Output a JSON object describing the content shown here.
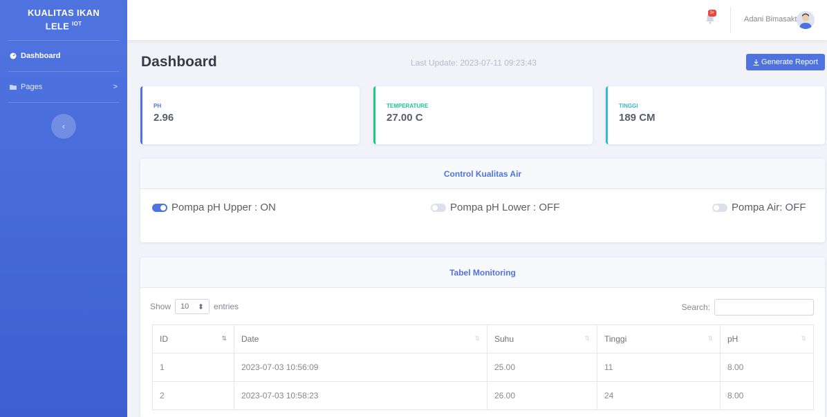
{
  "sidebar": {
    "brand_line1": "KUALITAS IKAN",
    "brand_line2": "LELE",
    "brand_sup": "IOT",
    "items": [
      {
        "label": "Dashboard",
        "icon": "tachometer-icon",
        "active": true
      },
      {
        "label": "Pages",
        "icon": "folder-icon",
        "chevron": ">"
      }
    ],
    "toggle_icon": "‹"
  },
  "topbar": {
    "notification_badge": "3+",
    "username": "Adani Bimasakti"
  },
  "page": {
    "title": "Dashboard",
    "last_update": "Last Update: 2023-07-11 09:23:43",
    "report_button": "Generate Report"
  },
  "stats": {
    "ph": {
      "label": "PH",
      "value": "2.96"
    },
    "temperature": {
      "label": "TEMPERATURE",
      "value": "27.00 C"
    },
    "tinggi": {
      "label": "TINGGI",
      "value": "189 CM"
    }
  },
  "control": {
    "title": "Control Kualitas Air",
    "switches": [
      {
        "label": "Pompa pH Upper : ON",
        "on": true
      },
      {
        "label": "Pompa pH Lower : OFF",
        "on": false
      },
      {
        "label": "Pompa Air: OFF",
        "on": false
      }
    ]
  },
  "monitoring": {
    "title": "Tabel Monitoring",
    "show_label": "Show",
    "entries_value": "10",
    "entries_label": "entries",
    "search_label": "Search:",
    "search_value": "",
    "columns": [
      "ID",
      "Date",
      "Suhu",
      "Tinggi",
      "pH"
    ],
    "rows": [
      [
        "1",
        "2023-07-03 10:56:09",
        "25.00",
        "11",
        "8.00"
      ],
      [
        "2",
        "2023-07-03 10:58:23",
        "26.00",
        "24",
        "8.00"
      ]
    ]
  },
  "colors": {
    "primary": "#4e73df",
    "success": "#1cc88a",
    "info": "#36b9cc",
    "danger": "#e74a3b"
  }
}
